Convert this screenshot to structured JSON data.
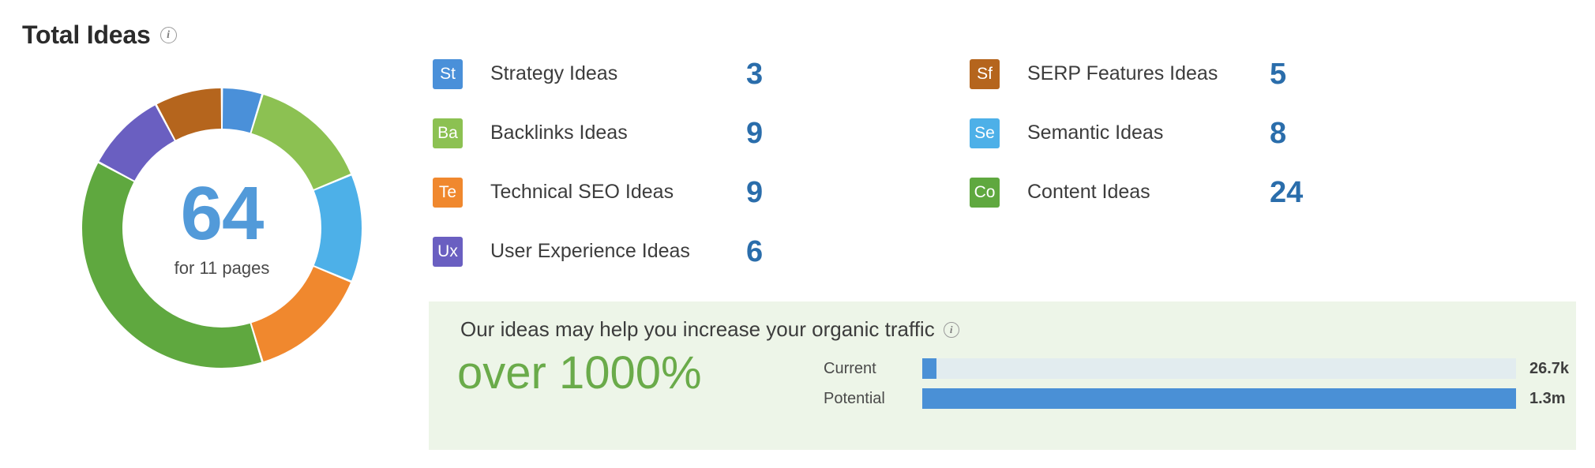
{
  "header": {
    "title": "Total Ideas",
    "info_icon": "info-icon",
    "info_glyph": "i"
  },
  "donut": {
    "total": "64",
    "subtitle": "for 11 pages",
    "total_color": "#529ad9"
  },
  "legend": {
    "left_column": [
      {
        "code": "St",
        "label": "Strategy Ideas",
        "value": "3",
        "color": "#4a90d9"
      },
      {
        "code": "Ba",
        "label": "Backlinks Ideas",
        "value": "9",
        "color": "#8cc152"
      },
      {
        "code": "Te",
        "label": "Technical SEO Ideas",
        "value": "9",
        "color": "#f0882e"
      },
      {
        "code": "Ux",
        "label": "User Experience Ideas",
        "value": "6",
        "color": "#6a5fc1"
      }
    ],
    "right_column": [
      {
        "code": "Sf",
        "label": "SERP Features Ideas",
        "value": "5",
        "color": "#b5651d"
      },
      {
        "code": "Se",
        "label": "Semantic Ideas",
        "value": "8",
        "color": "#4db0e8"
      },
      {
        "code": "Co",
        "label": "Content Ideas",
        "value": "24",
        "color": "#5fa83f"
      }
    ]
  },
  "traffic_panel": {
    "headline": "Our ideas may help you increase your organic traffic",
    "info_glyph": "i",
    "percent": "over 1000%",
    "percent_color": "#6aab4a",
    "background": "#edf5e8",
    "bars": [
      {
        "label": "Current",
        "value": "26.7k",
        "fill_percent": 2.4
      },
      {
        "label": "Potential",
        "value": "1.3m",
        "fill_percent": 100
      }
    ],
    "bar_fill_color": "#4a90d6",
    "bar_track_color": "#e2ecef"
  },
  "chart_data": {
    "type": "pie",
    "title": "Total Ideas",
    "center_label": "64",
    "center_sublabel": "for 11 pages",
    "total": 64,
    "categories": [
      "Strategy Ideas",
      "Backlinks Ideas",
      "Semantic Ideas",
      "Technical SEO Ideas",
      "Content Ideas",
      "User Experience Ideas",
      "SERP Features Ideas"
    ],
    "values": [
      3,
      9,
      8,
      9,
      24,
      6,
      5
    ],
    "colors": [
      "#4a90d9",
      "#8cc152",
      "#4db0e8",
      "#f0882e",
      "#5fa83f",
      "#6a5fc1",
      "#b5651d"
    ],
    "legend": "right",
    "donut": true,
    "start_angle_deg": 0,
    "direction": "clockwise"
  }
}
